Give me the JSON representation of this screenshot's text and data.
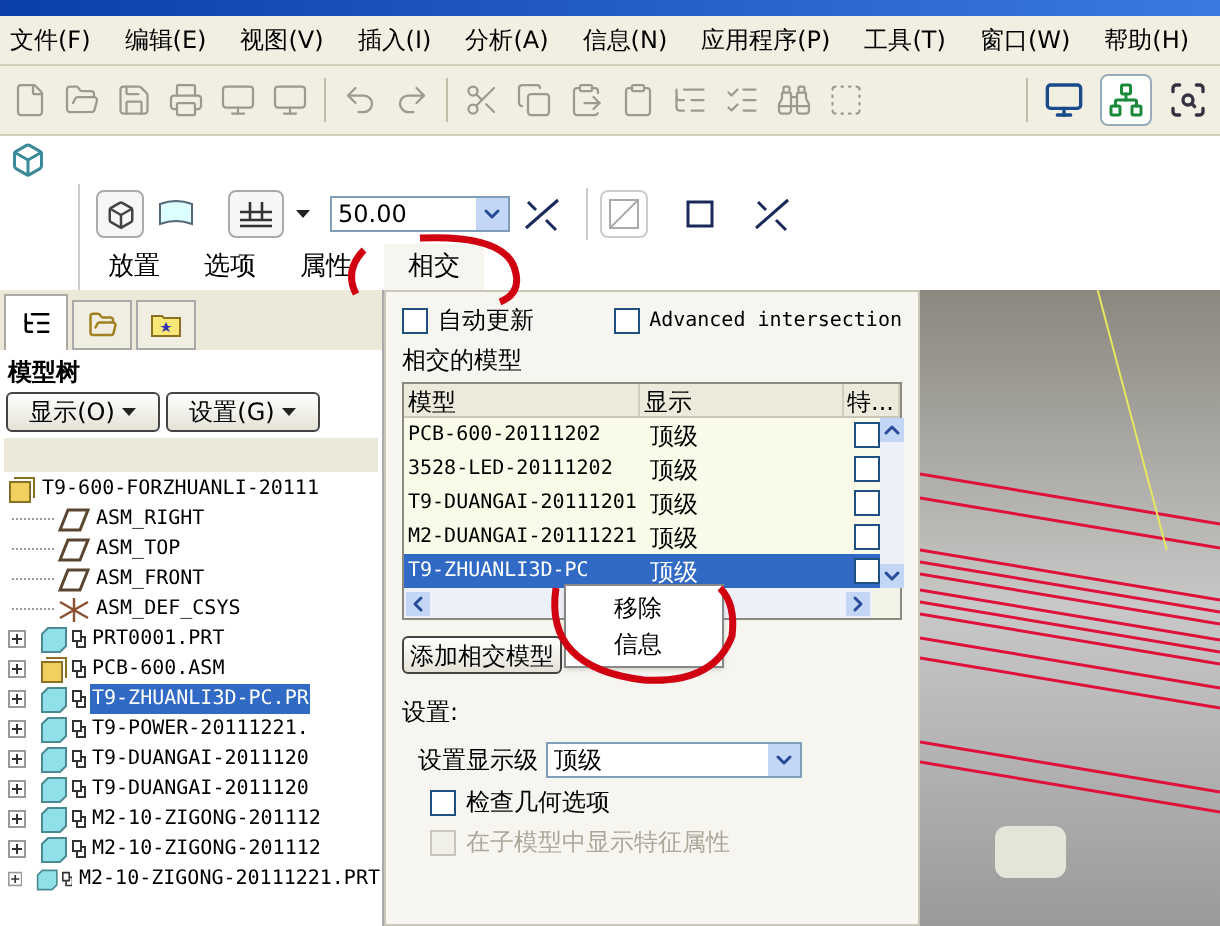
{
  "menu": [
    "文件(F)",
    "编辑(E)",
    "视图(V)",
    "插入(I)",
    "分析(A)",
    "信息(N)",
    "应用程序(P)",
    "工具(T)",
    "窗口(W)",
    "帮助(H)"
  ],
  "dashboard": {
    "depth_value": "50.00",
    "tabs": [
      {
        "label": "放置",
        "selected": false
      },
      {
        "label": "选项",
        "selected": false
      },
      {
        "label": "属性",
        "selected": false
      },
      {
        "label": "相交",
        "selected": true
      }
    ]
  },
  "model_tree": {
    "title": "模型树",
    "buttons": [
      "显示(O)",
      "设置(G)"
    ],
    "root": {
      "label": "T9-600-FORZHUANLI-20111",
      "children": [
        {
          "kind": "datum",
          "label": "ASM_RIGHT"
        },
        {
          "kind": "datum",
          "label": "ASM_TOP"
        },
        {
          "kind": "datum",
          "label": "ASM_FRONT"
        },
        {
          "kind": "csys",
          "label": "ASM_DEF_CSYS"
        },
        {
          "kind": "part",
          "label": "PRT0001.PRT",
          "expanded": false,
          "selected": false
        },
        {
          "kind": "assembly",
          "label": "PCB-600.ASM",
          "expanded": false,
          "selected": false
        },
        {
          "kind": "part",
          "label": "T9-ZHUANLI3D-PC.PR",
          "expanded": false,
          "selected": true
        },
        {
          "kind": "part",
          "label": "T9-POWER-20111221.",
          "expanded": false,
          "selected": false
        },
        {
          "kind": "part",
          "label": "T9-DUANGAI-2011120",
          "expanded": false,
          "selected": false
        },
        {
          "kind": "part",
          "label": "T9-DUANGAI-2011120",
          "expanded": false,
          "selected": false
        },
        {
          "kind": "part",
          "label": "M2-10-ZIGONG-201112",
          "expanded": false,
          "selected": false
        },
        {
          "kind": "part",
          "label": "M2-10-ZIGONG-201112",
          "expanded": false,
          "selected": false
        },
        {
          "kind": "part",
          "label": "M2-10-ZIGONG-20111221.PRT",
          "expanded": false,
          "selected": false
        }
      ]
    }
  },
  "intersection_panel": {
    "auto_update": {
      "label": "自动更新",
      "checked": false
    },
    "advanced": {
      "label": "Advanced intersection",
      "checked": false
    },
    "models_label": "相交的模型",
    "table": {
      "columns": [
        "模型",
        "显示",
        "特..."
      ],
      "rows": [
        {
          "model": "PCB-600-20111202",
          "display": "顶级",
          "checked": false,
          "selected": false
        },
        {
          "model": "3528-LED-20111202",
          "display": "顶级",
          "checked": false,
          "selected": false
        },
        {
          "model": "T9-DUANGAI-20111201",
          "display": "顶级",
          "checked": false,
          "selected": false
        },
        {
          "model": "M2-DUANGAI-20111221",
          "display": "顶级",
          "checked": false,
          "selected": false
        },
        {
          "model": "T9-ZHUANLI3D-PC",
          "display": "顶级",
          "checked": false,
          "selected": true
        }
      ]
    },
    "add_button": "添加相交模型",
    "settings_label": "设置:",
    "display_level": {
      "label": "设置显示级",
      "value": "顶级"
    },
    "check_geometry": {
      "label": "检查几何选项",
      "checked": false,
      "disabled": false
    },
    "show_feature_props": {
      "label": "在子模型中显示特征属性",
      "checked": false,
      "disabled": true
    }
  },
  "context_menu": [
    "移除",
    "信息"
  ]
}
